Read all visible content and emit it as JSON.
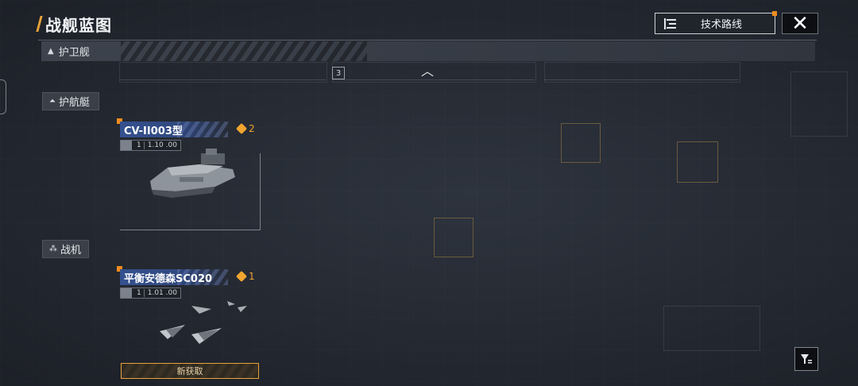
{
  "header": {
    "title": "战舰蓝图",
    "tech_button_label": "技术路线",
    "close_symbol": "✕"
  },
  "section": {
    "label": "护卫舰",
    "arrow": "▲"
  },
  "scroll_up_symbol": "︿",
  "page_marker": "3",
  "categories": [
    {
      "label": "护航艇",
      "icon": "escort-icon"
    },
    {
      "label": "战机",
      "icon": "fighter-icon"
    }
  ],
  "cards": [
    {
      "name": "CV-II003型",
      "quantity": "2",
      "level": "1",
      "stat_value": "1.10 .00",
      "new_label": ""
    },
    {
      "name": "平衡安德森SC020",
      "quantity": "1",
      "level": "1",
      "stat_value": "1.01 .00",
      "new_label": "新获取"
    }
  ],
  "colors": {
    "accent": "#f08c1e",
    "card_header": "#34518f",
    "background": "#262b34"
  }
}
